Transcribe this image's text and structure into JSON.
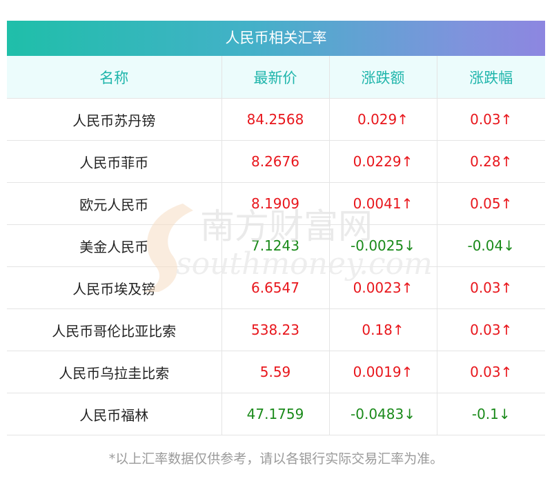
{
  "title": "人民币相关汇率",
  "columns": [
    "名称",
    "最新价",
    "涨跌额",
    "涨跌幅"
  ],
  "rows": [
    {
      "name": "人民币苏丹镑",
      "price": "84.2568",
      "change": "0.029↑",
      "pct": "0.03↑",
      "dir": "up"
    },
    {
      "name": "人民币菲币",
      "price": "8.2676",
      "change": "0.0229↑",
      "pct": "0.28↑",
      "dir": "up"
    },
    {
      "name": "欧元人民币",
      "price": "8.1909",
      "change": "0.0041↑",
      "pct": "0.05↑",
      "dir": "up"
    },
    {
      "name": "美金人民币",
      "price": "7.1243",
      "change": "-0.0025↓",
      "pct": "-0.04↓",
      "dir": "down"
    },
    {
      "name": "人民币埃及镑",
      "price": "6.6547",
      "change": "0.0023↑",
      "pct": "0.03↑",
      "dir": "up"
    },
    {
      "name": "人民币哥伦比亚比索",
      "price": "538.23",
      "change": "0.18↑",
      "pct": "0.03↑",
      "dir": "up"
    },
    {
      "name": "人民币乌拉圭比索",
      "price": "5.59",
      "change": "0.0019↑",
      "pct": "0.03↑",
      "dir": "up"
    },
    {
      "name": "人民币福林",
      "price": "47.1759",
      "change": "-0.0483↓",
      "pct": "-0.1↓",
      "dir": "down"
    }
  ],
  "watermark": {
    "cn": "南方财富网",
    "en": "southmoney.com"
  },
  "colors": {
    "up": "#e8161c",
    "down": "#1a8a1a",
    "header_text": "#1fb5ab",
    "header_bg": "#ecfcfc"
  },
  "footnote": "*以上汇率数据仅供参考，请以各银行实际交易汇率为准。"
}
